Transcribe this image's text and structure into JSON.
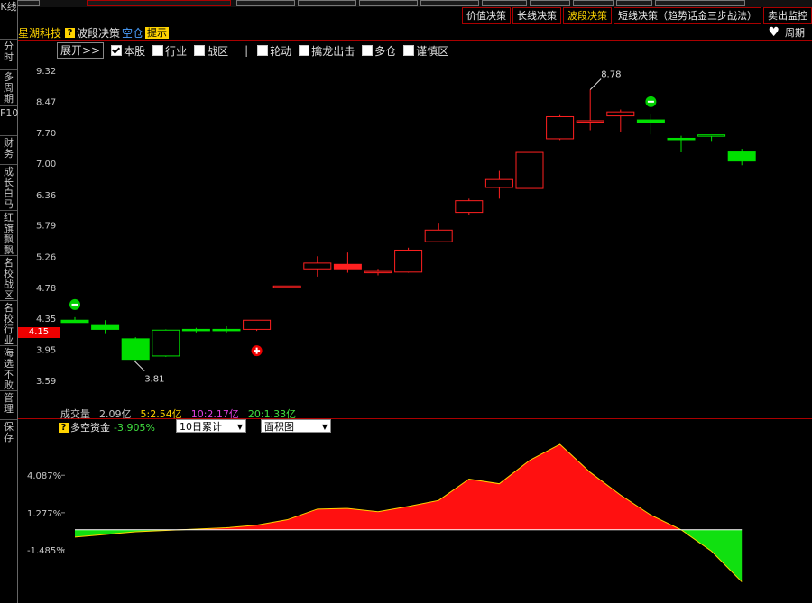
{
  "top_toolbar": [
    {
      "label": "价值决策",
      "active": false
    },
    {
      "label": "长线决策",
      "active": false
    },
    {
      "label": "波段决策",
      "active": true
    },
    {
      "label": "短线决策（趋势话金三步战法）",
      "active": false
    },
    {
      "label": "卖出监控",
      "active": false
    }
  ],
  "sidebar": [
    {
      "label": "K线",
      "y": 2
    },
    {
      "label": "分时",
      "y": 46
    },
    {
      "label": "多周期",
      "y": 80
    },
    {
      "label": "F10",
      "y": 120
    },
    {
      "label": "财务",
      "y": 153
    },
    {
      "label": "成长白马",
      "y": 185
    },
    {
      "label": "红旗飘飘",
      "y": 236
    },
    {
      "label": "名校战区",
      "y": 286
    },
    {
      "label": "名校行业",
      "y": 336
    },
    {
      "label": "海选不败",
      "y": 386
    },
    {
      "label": "管理",
      "y": 436
    },
    {
      "label": "保存",
      "y": 468
    }
  ],
  "title": {
    "stock_name": "星湖科技",
    "indicator": "波段决策",
    "status": "空仓",
    "hint": "提示"
  },
  "period": {
    "label": "周期"
  },
  "filters": {
    "expand_label": "展开>>",
    "group1": [
      {
        "label": "本股",
        "checked": true
      },
      {
        "label": "行业",
        "checked": false
      },
      {
        "label": "战区",
        "checked": false
      }
    ],
    "separator": "|",
    "group2": [
      {
        "label": "轮动",
        "checked": false
      },
      {
        "label": "擒龙出击",
        "checked": false
      },
      {
        "label": "多仓",
        "checked": false
      },
      {
        "label": "谨慎区",
        "checked": false
      }
    ]
  },
  "current_price": "4.15",
  "price_axis": [
    "9.32",
    "8.47",
    "7.70",
    "7.00",
    "6.36",
    "5.79",
    "5.26",
    "4.78",
    "4.35",
    "3.95",
    "3.59"
  ],
  "annotations": {
    "high": "8.78",
    "low": "3.81"
  },
  "volume": {
    "label": "成交量",
    "value": "2.09亿",
    "ma5": "5:2.54亿",
    "ma10": "10:2.17亿",
    "ma20": "20:1.33亿",
    "ma5_color": "#ffd400",
    "ma10_color": "#e040e0",
    "ma20_color": "#40e040"
  },
  "long_short": {
    "label": "多空资金",
    "value": "-3.905%",
    "select1": "10日累计",
    "select2": "面积图",
    "axis": [
      "4.087%",
      "1.277%",
      "-1.485%"
    ]
  },
  "colors": {
    "up": "#ff2020",
    "down": "#00e000",
    "grid": "#aa0000",
    "accent": "#ffd400"
  },
  "chart_data": {
    "type": "candlestick",
    "ylim": [
      3.4,
      9.6
    ],
    "candles": [
      {
        "o": 4.32,
        "h": 4.36,
        "l": 4.3,
        "c": 4.29
      },
      {
        "o": 4.25,
        "h": 4.32,
        "l": 4.14,
        "c": 4.2
      },
      {
        "o": 4.08,
        "h": 4.1,
        "l": 3.82,
        "c": 3.83
      },
      {
        "o": 4.19,
        "h": 4.2,
        "l": 3.86,
        "c": 3.87
      },
      {
        "o": 4.2,
        "h": 4.22,
        "l": 4.16,
        "c": 4.19
      },
      {
        "o": 4.2,
        "h": 4.24,
        "l": 4.15,
        "c": 4.19
      },
      {
        "o": 4.2,
        "h": 4.32,
        "l": 4.18,
        "c": 4.32
      },
      {
        "o": 4.8,
        "h": 4.8,
        "l": 4.8,
        "c": 4.8
      },
      {
        "o": 5.06,
        "h": 5.26,
        "l": 4.94,
        "c": 5.15
      },
      {
        "o": 5.06,
        "h": 5.32,
        "l": 5.0,
        "c": 5.13
      },
      {
        "o": 5.01,
        "h": 5.06,
        "l": 4.96,
        "c": 5.02
      },
      {
        "o": 5.01,
        "h": 5.4,
        "l": 5.0,
        "c": 5.36
      },
      {
        "o": 5.5,
        "h": 5.83,
        "l": 5.5,
        "c": 5.7
      },
      {
        "o": 6.02,
        "h": 6.28,
        "l": 5.98,
        "c": 6.24
      },
      {
        "o": 6.5,
        "h": 6.84,
        "l": 6.28,
        "c": 6.66
      },
      {
        "o": 6.48,
        "h": 7.24,
        "l": 6.48,
        "c": 7.24
      },
      {
        "o": 7.55,
        "h": 8.12,
        "l": 7.52,
        "c": 8.08
      },
      {
        "o": 7.95,
        "h": 8.78,
        "l": 7.75,
        "c": 7.98
      },
      {
        "o": 8.1,
        "h": 8.26,
        "l": 7.7,
        "c": 8.2
      },
      {
        "o": 8.0,
        "h": 8.14,
        "l": 7.65,
        "c": 7.93
      },
      {
        "o": 7.56,
        "h": 7.62,
        "l": 7.24,
        "c": 7.55
      },
      {
        "o": 7.64,
        "h": 7.64,
        "l": 7.5,
        "c": 7.61
      },
      {
        "o": 7.25,
        "h": 7.32,
        "l": 6.96,
        "c": 7.05
      }
    ],
    "signals": [
      {
        "index": 0,
        "type": "sell"
      },
      {
        "index": 6,
        "type": "buy"
      },
      {
        "index": 19,
        "type": "sell"
      }
    ],
    "area": {
      "ylim": [
        -4.2,
        6.6
      ],
      "values": [
        -0.55,
        -0.35,
        -0.15,
        -0.05,
        0.05,
        0.15,
        0.35,
        0.75,
        1.55,
        1.6,
        1.35,
        1.75,
        2.2,
        3.8,
        3.45,
        5.2,
        6.4,
        4.3,
        2.6,
        1.1,
        0.0,
        -1.6,
        -3.9
      ]
    }
  }
}
